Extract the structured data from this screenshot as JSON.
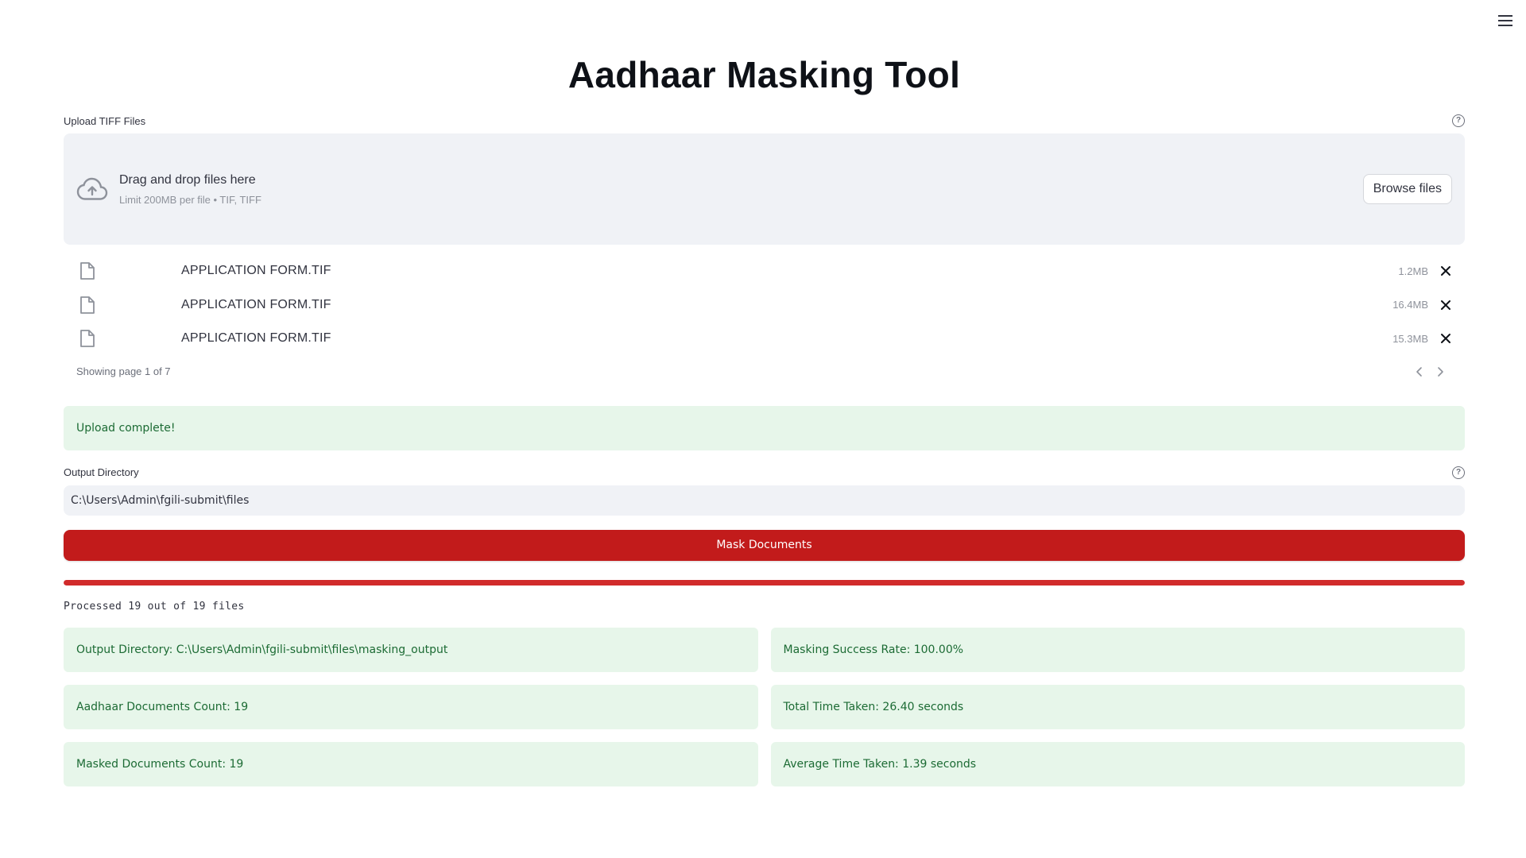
{
  "title": "Aadhaar Masking Tool",
  "uploader": {
    "label": "Upload TIFF Files",
    "drag_text": "Drag and drop files here",
    "limit_text": "Limit 200MB per file • TIF, TIFF",
    "browse_label": "Browse files",
    "files": [
      {
        "name": "APPLICATION FORM.TIF",
        "size": "1.2MB"
      },
      {
        "name": "APPLICATION FORM.TIF",
        "size": "16.4MB"
      },
      {
        "name": "APPLICATION FORM.TIF",
        "size": "15.3MB"
      }
    ],
    "pagination_text": "Showing page 1 of 7"
  },
  "upload_status": "Upload complete!",
  "output_directory": {
    "label": "Output Directory",
    "value": "C:\\Users\\Admin\\fgili-submit\\files"
  },
  "mask_button_label": "Mask Documents",
  "progress": {
    "fraction": 1.0,
    "text": "Processed 19 out of 19 files"
  },
  "stats": [
    "Output Directory: C:\\Users\\Admin\\fgili-submit\\files\\masking_output",
    "Masking Success Rate: 100.00%",
    "Aadhaar Documents Count: 19",
    "Total Time Taken: 26.40 seconds",
    "Masked Documents Count: 19",
    "Average Time Taken: 1.39 seconds"
  ],
  "colors": {
    "primary": "#c21b1b",
    "success_bg": "#e7f6ea",
    "success_text": "#1c6b34",
    "input_bg": "#f0f2f6"
  },
  "icons": [
    "menu-icon",
    "help-icon",
    "cloud-upload-icon",
    "file-icon",
    "close-icon",
    "chevron-left-icon",
    "chevron-right-icon"
  ]
}
